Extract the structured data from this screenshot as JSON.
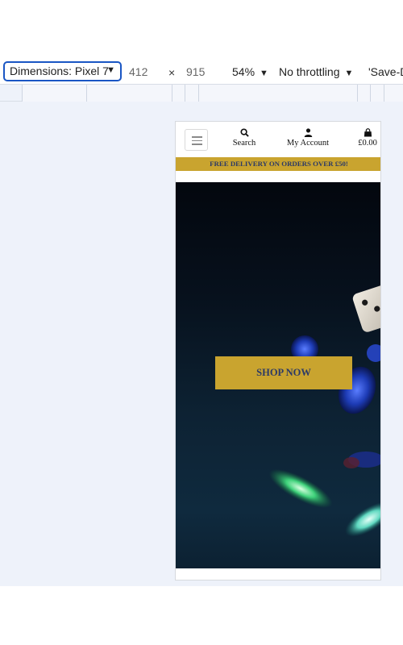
{
  "devtools": {
    "device_label": "Dimensions: Pixel 7",
    "width": "412",
    "times": "×",
    "height": "915",
    "zoom": "54%",
    "throttling": "No throttling",
    "save_label": "'Save-D"
  },
  "site": {
    "nav": {
      "search_label": "Search",
      "account_label": "My Account",
      "cart_total": "£0.00"
    },
    "banner_text": "FREE DELIVERY ON ORDERS OVER £50!",
    "hero": {
      "cta_label": "SHOP NOW"
    },
    "colors": {
      "accent_gold": "#c9a42f",
      "text_navy": "#2c3a66"
    }
  }
}
